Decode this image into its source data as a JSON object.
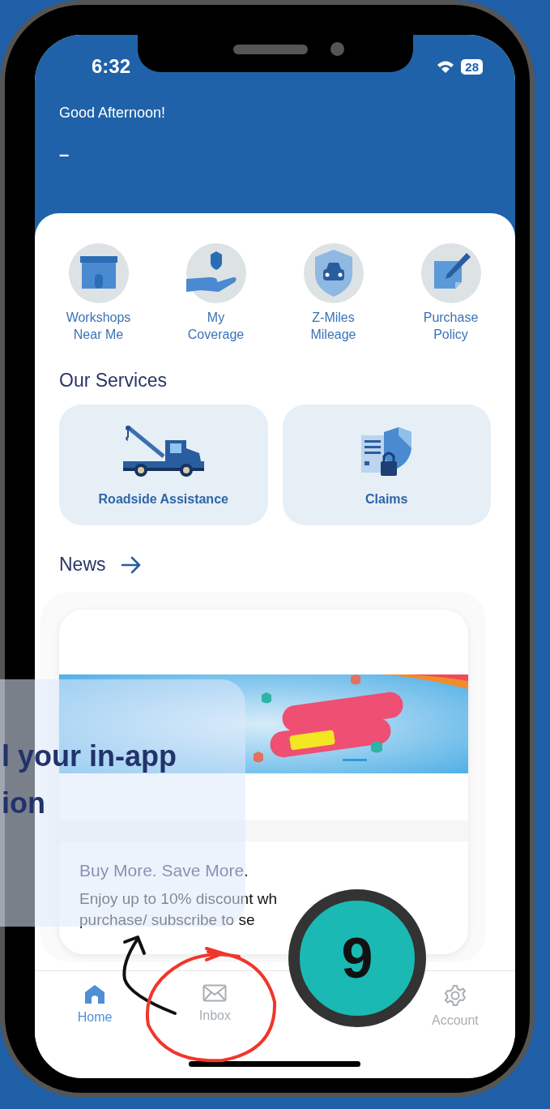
{
  "status_bar": {
    "time": "6:32",
    "battery": "28"
  },
  "greeting": "Good Afternoon!",
  "user_name": "–",
  "quick_actions": [
    {
      "kind": "shop",
      "lines": [
        "Workshops",
        "Near Me"
      ]
    },
    {
      "kind": "coverage",
      "lines": [
        "My",
        "Coverage"
      ]
    },
    {
      "kind": "car",
      "lines": [
        "Z-Miles",
        "Mileage"
      ]
    },
    {
      "kind": "policy",
      "lines": [
        "Purchase",
        "Policy"
      ]
    }
  ],
  "services": {
    "title": "Our Services",
    "items": [
      {
        "kind": "tow",
        "label": "Roadside Assistance"
      },
      {
        "kind": "claim",
        "label": "Claims"
      }
    ]
  },
  "news": {
    "title": "News",
    "items": [
      {
        "kind": "picture",
        "title": "Buy More. Save More.",
        "description": [
          "Enjoy up to 10% discount wh",
          "purchase/ subscribe to se"
        ]
      }
    ]
  },
  "tab_bar": [
    {
      "kind": "home",
      "label": "Home",
      "selected": true
    },
    {
      "kind": "inbox",
      "label": "Inbox",
      "selected": false
    },
    {
      "kind": "account",
      "label": "Account",
      "selected": false
    }
  ],
  "callout": {
    "lines": [
      "l your in-app",
      "ion"
    ]
  },
  "step_badge": "9"
}
